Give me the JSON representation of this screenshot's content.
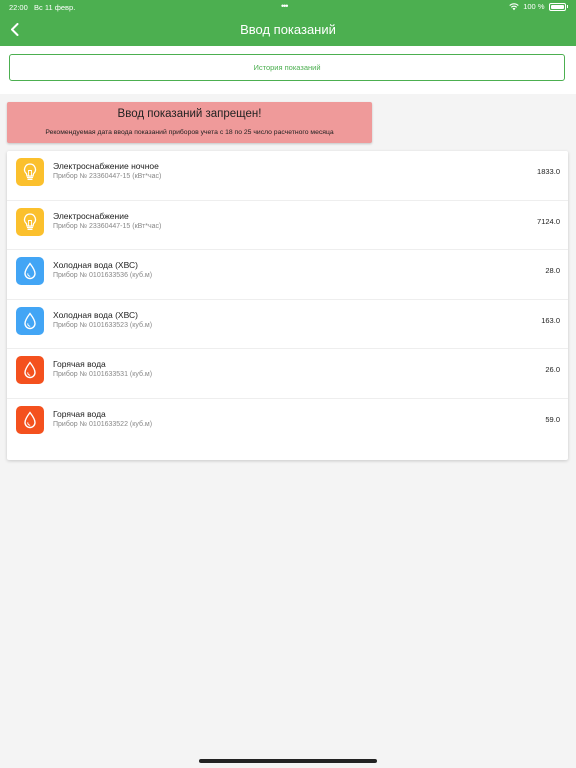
{
  "status_bar": {
    "time": "22:00",
    "date": "Вс 11 февр.",
    "dots": "•••",
    "battery": "100 %"
  },
  "header": {
    "title": "Ввод показаний",
    "back_icon": "chevron-left-icon",
    "color": "#4caf50"
  },
  "history_button": {
    "label": "История показаний"
  },
  "warning": {
    "title": "Ввод показаний запрещен!",
    "text": "Рекомендуемая дата ввода показаний приборов учета с 18 по 25 число расчетного месяца",
    "color": "#ef9a9a"
  },
  "meters": [
    {
      "name": "Электроснабжение ночное",
      "device": "Прибор № 23360447-15 (кВт*час)",
      "value": "1833.0",
      "icon": "lightbulb-icon",
      "color": "#fbc02d"
    },
    {
      "name": "Электроснабжение",
      "device": "Прибор № 23360447-15 (кВт*час)",
      "value": "7124.0",
      "icon": "lightbulb-icon",
      "color": "#fbc02d"
    },
    {
      "name": "Холодная вода (ХВС)",
      "device": "Прибор № 0101633536 (куб.м)",
      "value": "28.0",
      "icon": "water-drop-icon",
      "color": "#42a5f5"
    },
    {
      "name": "Холодная вода (ХВС)",
      "device": "Прибор № 0101633523 (куб.м)",
      "value": "163.0",
      "icon": "water-drop-icon",
      "color": "#42a5f5"
    },
    {
      "name": "Горячая вода",
      "device": "Прибор № 0101633531 (куб.м)",
      "value": "26.0",
      "icon": "water-drop-icon",
      "color": "#f4511e"
    },
    {
      "name": "Горячая вода",
      "device": "Прибор № 0101633522 (куб.м)",
      "value": "59.0",
      "icon": "water-drop-icon",
      "color": "#f4511e"
    }
  ]
}
